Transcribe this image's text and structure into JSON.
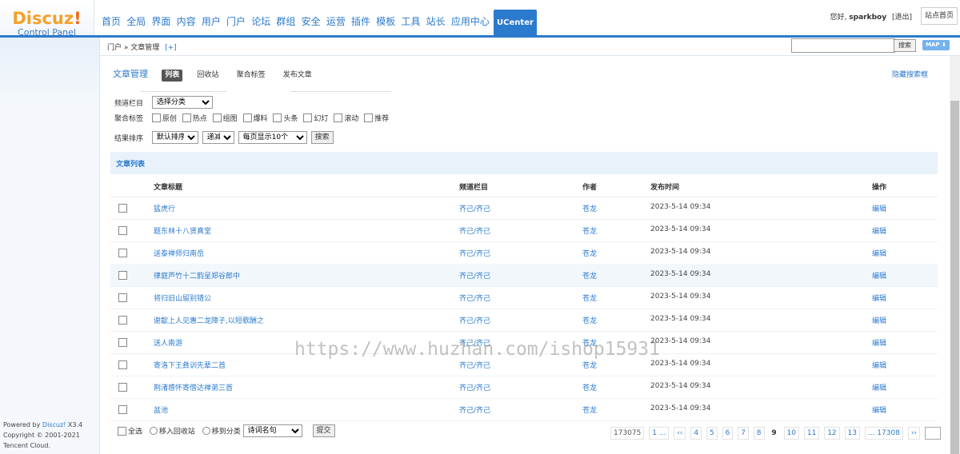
{
  "logo": {
    "brand": "Discuz",
    "bang": "!",
    "sub": "Control Panel"
  },
  "topnav": [
    "首页",
    "全局",
    "界面",
    "内容",
    "用户",
    "门户",
    "论坛",
    "群组",
    "安全",
    "运营",
    "插件",
    "模板",
    "工具",
    "站长",
    "应用中心",
    "UCenter"
  ],
  "user": {
    "greeting": "您好,",
    "name": "sparkboy",
    "logout": "[退出]"
  },
  "site_home": "站点首页",
  "breadcrumb": {
    "path": "门户 » 文章管理",
    "add": "[+]"
  },
  "top_search": {
    "button": "搜索",
    "map": "MAP ⬇"
  },
  "page": {
    "title": "文章管理",
    "tabs": [
      "列表",
      "回收站",
      "聚合标签",
      "发布文章"
    ],
    "hide_search": "隐藏搜索框"
  },
  "filters": {
    "channel_label": "频道栏目",
    "channel_value": "选择分类",
    "tag_label": "聚合标签",
    "tags": [
      "原创",
      "热点",
      "组图",
      "爆料",
      "头条",
      "幻灯",
      "滚动",
      "推荐"
    ],
    "sort_label": "结果排序",
    "sort_value": "默认排序",
    "order_value": "递减",
    "per_page_value": "每页显示10个",
    "search_button": "搜索"
  },
  "list": {
    "header": "文章列表",
    "columns": [
      "文章标题",
      "频道栏目",
      "作者",
      "发布时间",
      "操作"
    ],
    "rows": [
      {
        "title": "猛虎行",
        "category": "齐己/齐己",
        "author": "苍龙",
        "date": "2023-5-14 09:34",
        "action": "编辑"
      },
      {
        "title": "题东林十八贤真堂",
        "category": "齐己/齐己",
        "author": "苍龙",
        "date": "2023-5-14 09:34",
        "action": "编辑"
      },
      {
        "title": "送泰禅师归南岳",
        "category": "齐己/齐己",
        "author": "苍龙",
        "date": "2023-5-14 09:34",
        "action": "编辑"
      },
      {
        "title": "律庭芦竹十二韵呈郑谷郎中",
        "category": "齐己/齐己",
        "author": "苍龙",
        "date": "2023-5-14 09:34",
        "action": "编辑"
      },
      {
        "title": "将归旧山留别错公",
        "category": "齐己/齐己",
        "author": "苍龙",
        "date": "2023-5-14 09:34",
        "action": "编辑"
      },
      {
        "title": "谢歙上人见惠二龙障子,以短歌酬之",
        "category": "齐己/齐己",
        "author": "苍龙",
        "date": "2023-5-14 09:34",
        "action": "编辑"
      },
      {
        "title": "送人南游",
        "category": "齐己/齐己",
        "author": "苍龙",
        "date": "2023-5-14 09:34",
        "action": "编辑"
      },
      {
        "title": "寄洛下王彝训先辈二首",
        "category": "齐己/齐己",
        "author": "苍龙",
        "date": "2023-5-14 09:34",
        "action": "编辑"
      },
      {
        "title": "荆渚感怀寄僧达禅弟三首",
        "category": "齐己/齐己",
        "author": "苍龙",
        "date": "2023-5-14 09:34",
        "action": "编辑"
      },
      {
        "title": "盆池",
        "category": "齐己/齐己",
        "author": "苍龙",
        "date": "2023-5-14 09:34",
        "action": "编辑"
      }
    ]
  },
  "bottom": {
    "select_all": "全选",
    "move_to_recycle": "移入回收站",
    "move_to_category": "移到分类",
    "category_value": "诗词名句",
    "submit": "提交"
  },
  "pager": {
    "total": "173075",
    "first": "1 ...",
    "prev": "‹‹",
    "pages": [
      "4",
      "5",
      "6",
      "7",
      "8"
    ],
    "current": "9",
    "pages_after": [
      "10",
      "11",
      "12",
      "13"
    ],
    "last": "... 17308",
    "next": "››"
  },
  "footer": {
    "powered": "Powered by",
    "brand": "Discuz!",
    "version": "X3.4",
    "copyright": "Copyright © 2001-2021",
    "company": "Tencent Cloud."
  },
  "watermark": "https://www.huzhan.com/ishop15931"
}
